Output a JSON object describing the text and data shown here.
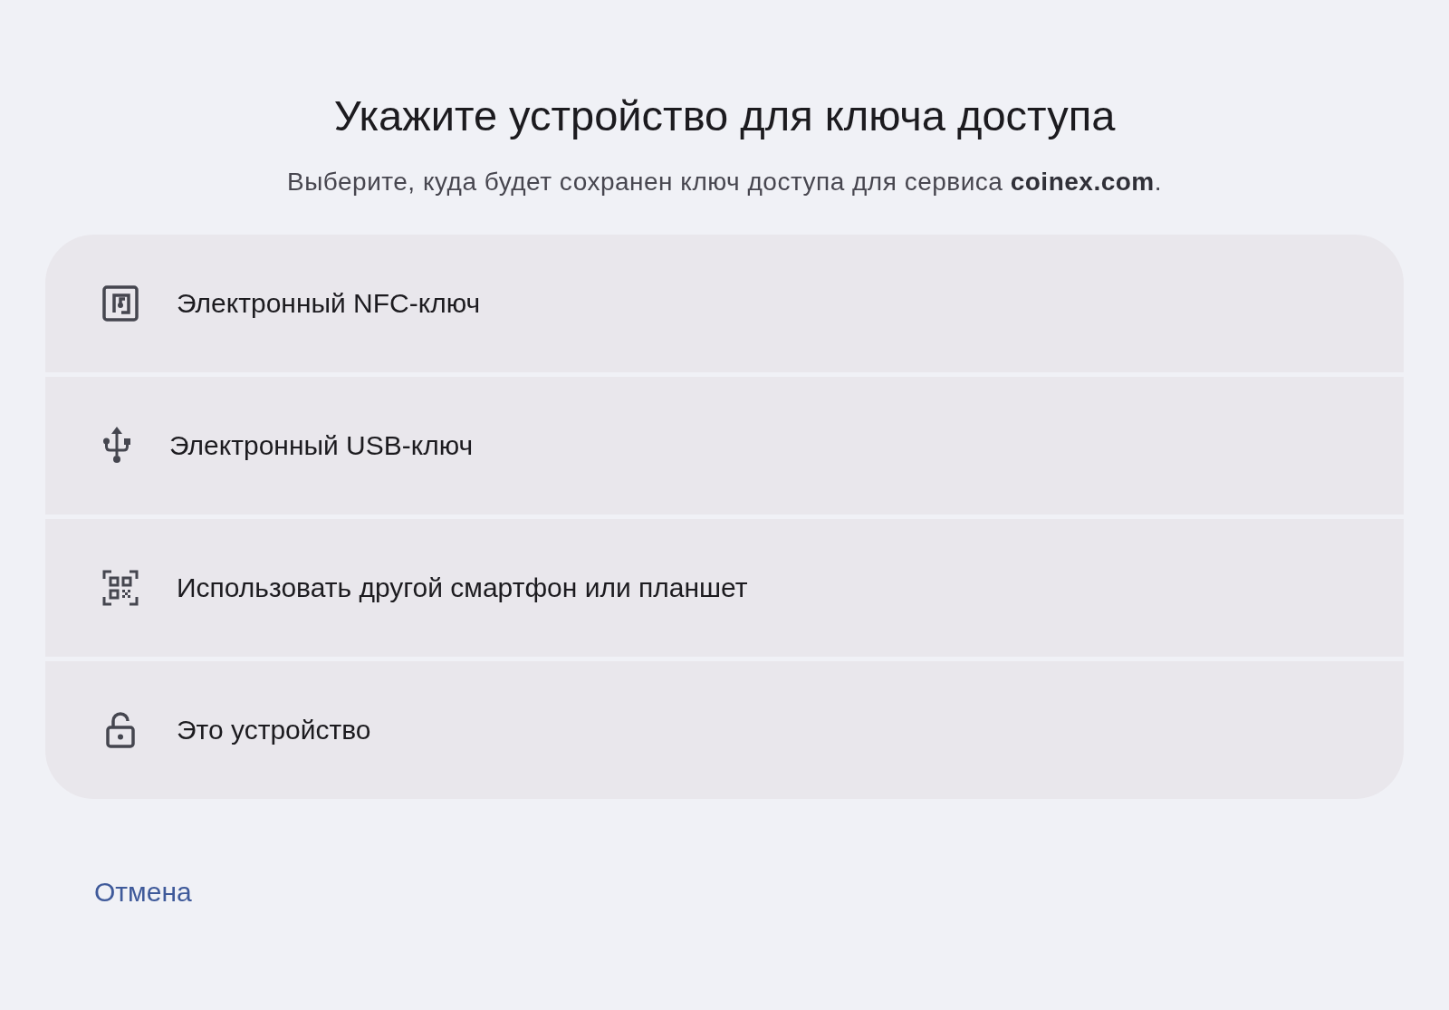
{
  "title": "Укажите устройство для ключа доступа",
  "subtitle": "Выберите, куда будет сохранен ключ доступа для сервиса **coinex.com**.",
  "options": [
    {
      "kind": "nfc",
      "label": "Электронный NFC-ключ"
    },
    {
      "kind": "usb",
      "label": "Электронный USB-ключ"
    },
    {
      "kind": "qr",
      "label": "Использовать другой смартфон или планшет"
    },
    {
      "kind": "lock",
      "label": "Это устройство"
    }
  ],
  "cancel": "Отмена"
}
